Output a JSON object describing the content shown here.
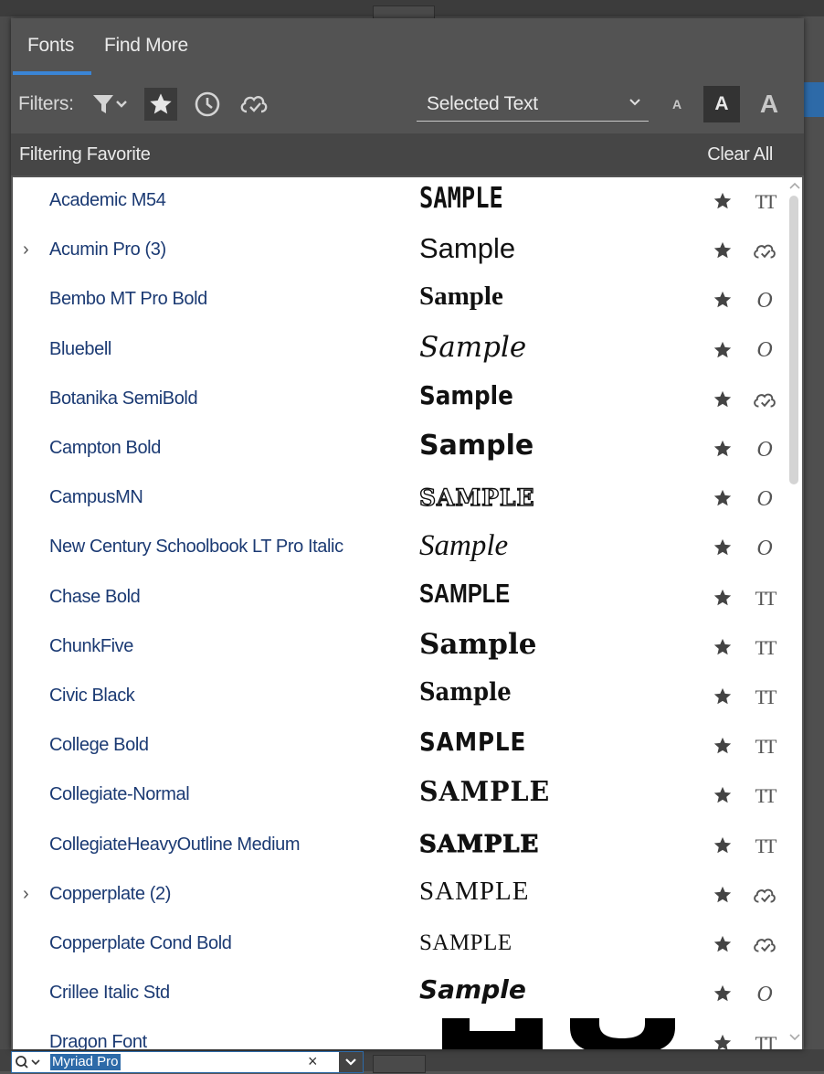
{
  "tabs": [
    {
      "label": "Fonts",
      "active": true
    },
    {
      "label": "Find More",
      "active": false
    }
  ],
  "filters": {
    "label": "Filters:",
    "icons": [
      "filter-dropdown-icon",
      "star-filter-icon",
      "recent-clock-icon",
      "cloud-activated-icon"
    ],
    "active_filter": "star-filter-icon",
    "preview_text_select": "Selected Text",
    "size_buttons": [
      "A",
      "A",
      "A"
    ],
    "selected_size": "medium"
  },
  "filtering_bar": {
    "text": "Filtering Favorite",
    "clear_label": "Clear All"
  },
  "fonts": [
    {
      "name": "Academic M54",
      "sample": "SAMPLE",
      "expandable": false,
      "source": "tt-icon",
      "favorite": true
    },
    {
      "name": "Acumin Pro (3)",
      "sample": "Sample",
      "expandable": true,
      "source": "cloud-icon",
      "favorite": true
    },
    {
      "name": "Bembo MT Pro Bold",
      "sample": "Sample",
      "expandable": false,
      "source": "opentype-icon",
      "favorite": true
    },
    {
      "name": "Bluebell",
      "sample": "Sample",
      "expandable": false,
      "source": "opentype-icon",
      "favorite": true
    },
    {
      "name": "Botanika SemiBold",
      "sample": "Sample",
      "expandable": false,
      "source": "cloud-icon",
      "favorite": true
    },
    {
      "name": "Campton Bold",
      "sample": "Sample",
      "expandable": false,
      "source": "opentype-icon",
      "favorite": true
    },
    {
      "name": "CampusMN",
      "sample": "SAMPLE",
      "expandable": false,
      "source": "opentype-icon",
      "favorite": true
    },
    {
      "name": "New Century Schoolbook LT Pro Italic",
      "sample": "Sample",
      "expandable": false,
      "source": "opentype-icon",
      "favorite": true
    },
    {
      "name": "Chase Bold",
      "sample": "SAMPLE",
      "expandable": false,
      "source": "tt-icon",
      "favorite": true
    },
    {
      "name": "ChunkFive",
      "sample": "Sample",
      "expandable": false,
      "source": "tt-icon",
      "favorite": true
    },
    {
      "name": "Civic Black",
      "sample": "Sample",
      "expandable": false,
      "source": "tt-icon",
      "favorite": true
    },
    {
      "name": "College Bold",
      "sample": "SAMPLE",
      "expandable": false,
      "source": "tt-icon",
      "favorite": true
    },
    {
      "name": "Collegiate-Normal",
      "sample": "SAMPLE",
      "expandable": false,
      "source": "tt-icon",
      "favorite": true
    },
    {
      "name": "CollegiateHeavyOutline Medium",
      "sample": "SAMPLE",
      "expandable": false,
      "source": "tt-icon",
      "favorite": true
    },
    {
      "name": "Copperplate (2)",
      "sample": "SAMPLE",
      "expandable": true,
      "source": "cloud-icon",
      "favorite": true
    },
    {
      "name": "Copperplate Cond Bold",
      "sample": "SAMPLE",
      "expandable": false,
      "source": "cloud-icon",
      "favorite": true
    },
    {
      "name": "Crillee Italic Std",
      "sample": "Sample",
      "expandable": false,
      "source": "opentype-icon",
      "favorite": true
    },
    {
      "name": "Dragon Font",
      "sample": "",
      "expandable": false,
      "source": "tt-icon",
      "favorite": true
    }
  ],
  "source_glyphs": {
    "tt-icon": "TT",
    "opentype-icon": "O"
  },
  "search": {
    "value": "Myriad Pro",
    "clear_glyph": "×"
  },
  "colors": {
    "accent": "#3a85d6",
    "panel_bg": "#535353",
    "font_name": "#1b3a73"
  }
}
